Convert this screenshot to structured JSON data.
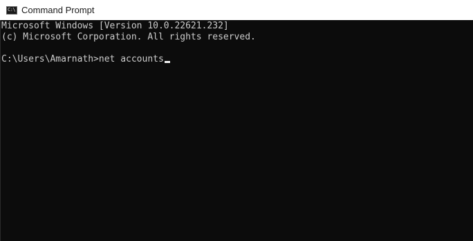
{
  "window": {
    "title": "Command Prompt",
    "icon": "cmd-icon",
    "icon_glyph": "C:\\",
    "colors": {
      "titlebar_bg": "#ffffff",
      "console_bg": "#0c0c0c",
      "console_text": "#cccccc",
      "cursor": "#f2f2f2"
    }
  },
  "console": {
    "lines": [
      "Microsoft Windows [Version 10.0.22621.232]",
      "(c) Microsoft Corporation. All rights reserved.",
      ""
    ],
    "prompt": "C:\\Users\\Amarnath>",
    "command": "net accounts"
  }
}
